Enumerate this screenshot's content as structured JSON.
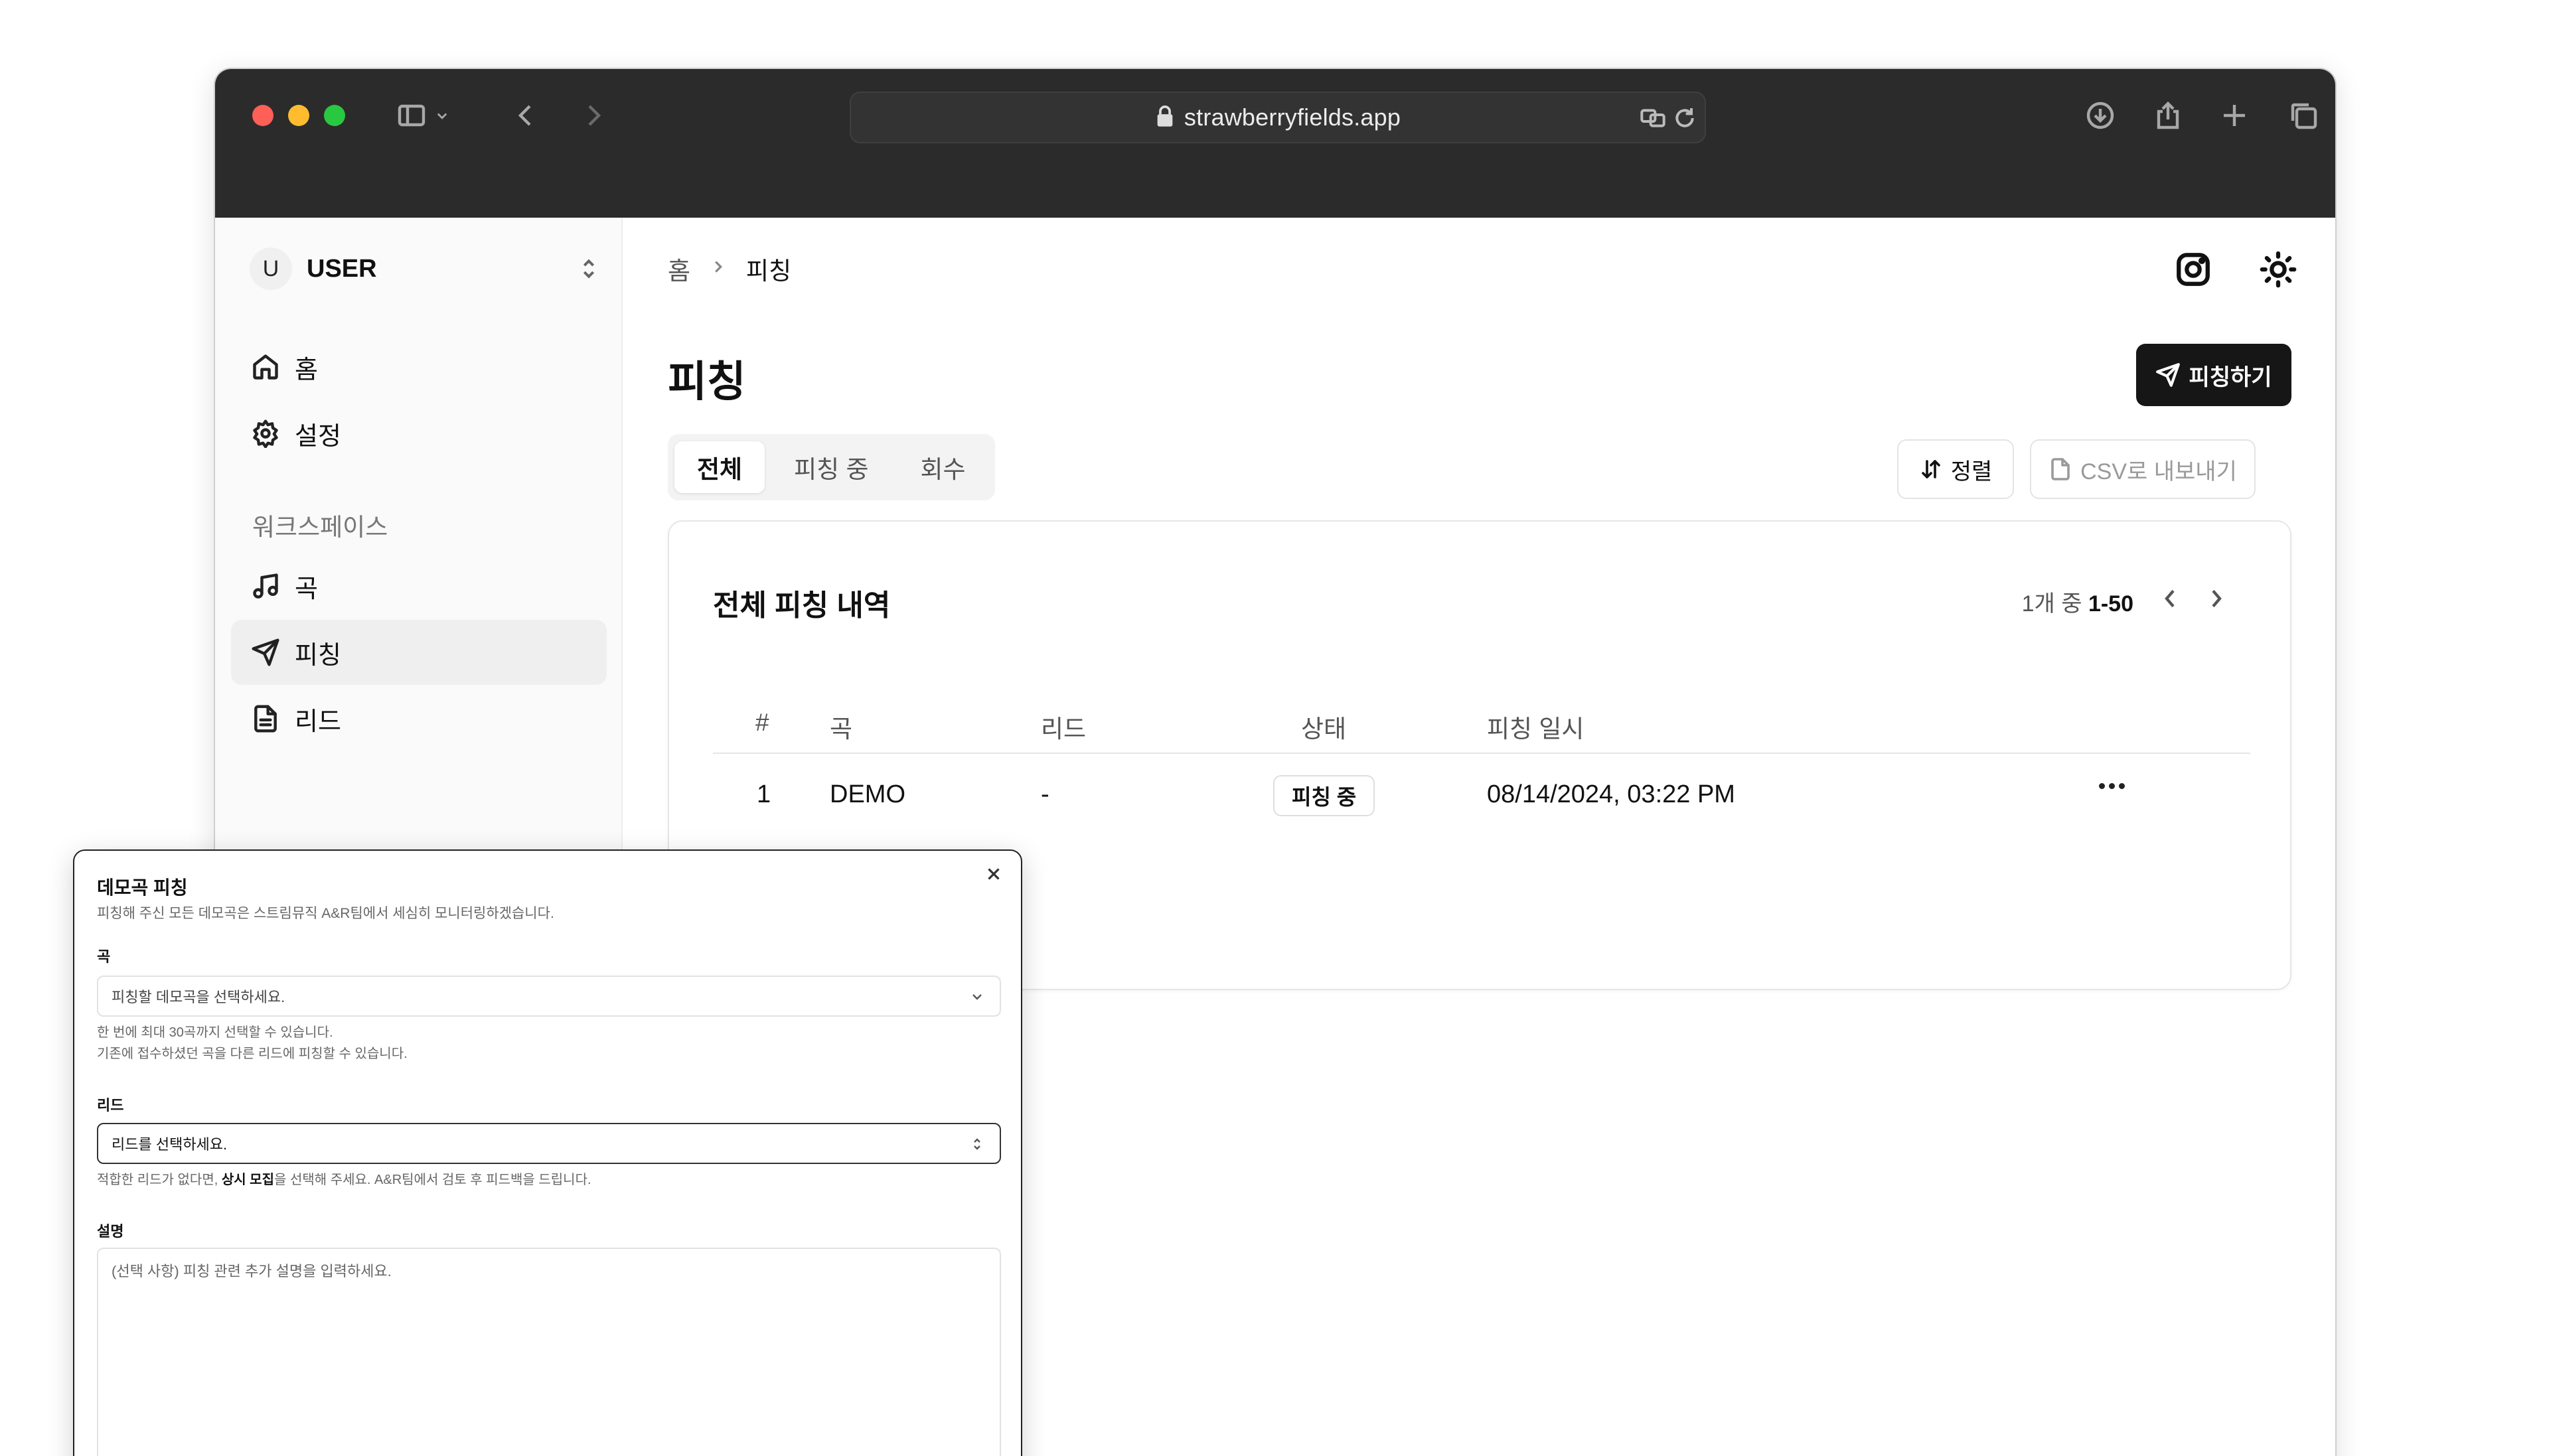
{
  "browser": {
    "url": "strawberryfields.app",
    "icons": [
      "sidebar-toggle-icon",
      "chevron-down-icon",
      "back-icon",
      "forward-icon",
      "lock-icon",
      "translate-icon",
      "reload-icon",
      "download-icon",
      "share-icon",
      "new-tab-icon",
      "tabs-overview-icon"
    ]
  },
  "sidebar": {
    "user": {
      "initial": "U",
      "name": "USER"
    },
    "nav": [
      {
        "label": "홈",
        "icon": "home-icon"
      },
      {
        "label": "설정",
        "icon": "gear-icon"
      }
    ],
    "section_label": "워크스페이스",
    "workspace": [
      {
        "label": "곡",
        "icon": "music-note-icon"
      },
      {
        "label": "피칭",
        "icon": "send-icon",
        "active": true
      },
      {
        "label": "리드",
        "icon": "document-icon"
      }
    ]
  },
  "header": {
    "breadcrumb": [
      "홈",
      "피칭"
    ],
    "icons": [
      "instagram-icon",
      "sun-icon"
    ]
  },
  "page": {
    "title": "피칭",
    "primary_button": "피칭하기",
    "tabs": [
      {
        "label": "전체",
        "active": true
      },
      {
        "label": "피칭 중"
      },
      {
        "label": "회수"
      }
    ],
    "sort_button": "정렬",
    "export_button": "CSV로 내보내기"
  },
  "table": {
    "title": "전체 피칭 내역",
    "pagination": {
      "prefix": "1개 중 ",
      "range": "1-50"
    },
    "columns": [
      "#",
      "곡",
      "리드",
      "상태",
      "피칭 일시"
    ],
    "rows": [
      {
        "num": "1",
        "song": "DEMO",
        "lead": "-",
        "status": "피칭 중",
        "date": "08/14/2024, 03:22 PM"
      }
    ]
  },
  "modal": {
    "title": "데모곡 피칭",
    "subtitle": "피칭해 주신 모든 데모곡은 스트림뮤직 A&R팀에서 세심히 모니터링하겠습니다.",
    "song_label": "곡",
    "song_placeholder": "피칭할 데모곡을 선택하세요.",
    "song_hint_1": "한 번에 최대 30곡까지 선택할 수 있습니다.",
    "song_hint_2": "기존에 접수하셨던 곡을 다른 리드에 피칭할 수 있습니다.",
    "lead_label": "리드",
    "lead_placeholder": "리드를 선택하세요.",
    "lead_hint_pre": "적합한 리드가 없다면, ",
    "lead_hint_bold": "상시 모집",
    "lead_hint_post": "을 선택해 주세요. A&R팀에서 검토 후 피드백을 드립니다.",
    "desc_label": "설명",
    "desc_placeholder": "(선택 사항) 피칭 관련 추가 설명을 입력하세요."
  },
  "colors": {
    "primary": "#161616",
    "titlebar": "#2b2b2b",
    "traffic_red": "#fe5f57",
    "traffic_yellow": "#febc2e",
    "traffic_green": "#28c840"
  }
}
